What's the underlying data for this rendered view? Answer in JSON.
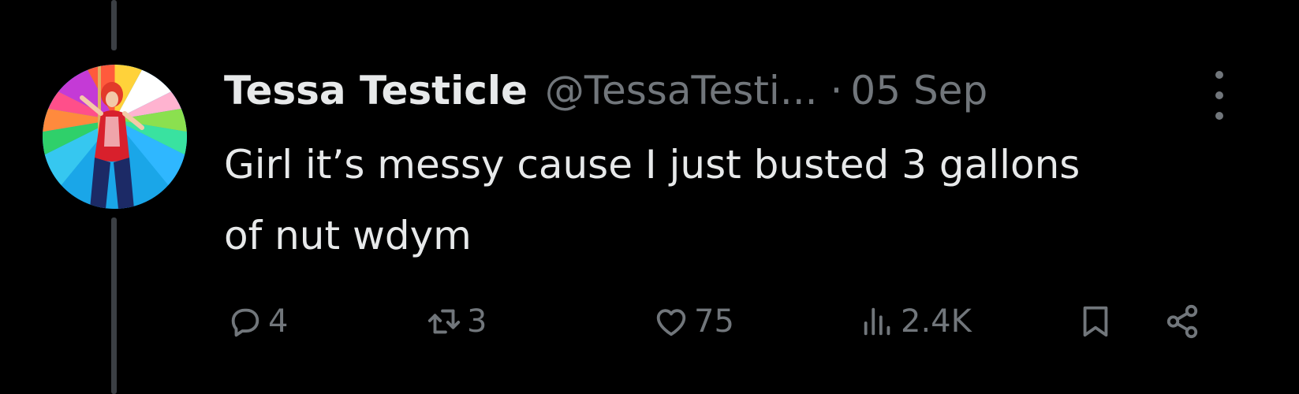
{
  "tweet": {
    "author": {
      "display_name": "Tessa Testicle",
      "handle": "@TessaTesti...",
      "avatar": "avatar-image"
    },
    "separator": "·",
    "date": "05 Sep",
    "text": "Girl it’s messy cause I just busted 3 gallons of nut wdym",
    "menu_icon": "more-vertical-icon"
  },
  "actions": {
    "reply": {
      "icon": "reply-icon",
      "count": "4"
    },
    "retweet": {
      "icon": "retweet-icon",
      "count": "3"
    },
    "like": {
      "icon": "heart-icon",
      "count": "75"
    },
    "views": {
      "icon": "views-icon",
      "count": "2.4K"
    },
    "bookmark": {
      "icon": "bookmark-icon"
    },
    "share": {
      "icon": "share-icon"
    }
  },
  "colors": {
    "background": "#000000",
    "primary_text": "#e7e9ea",
    "secondary_text": "#71767b",
    "thread_line": "#3b3f44"
  }
}
